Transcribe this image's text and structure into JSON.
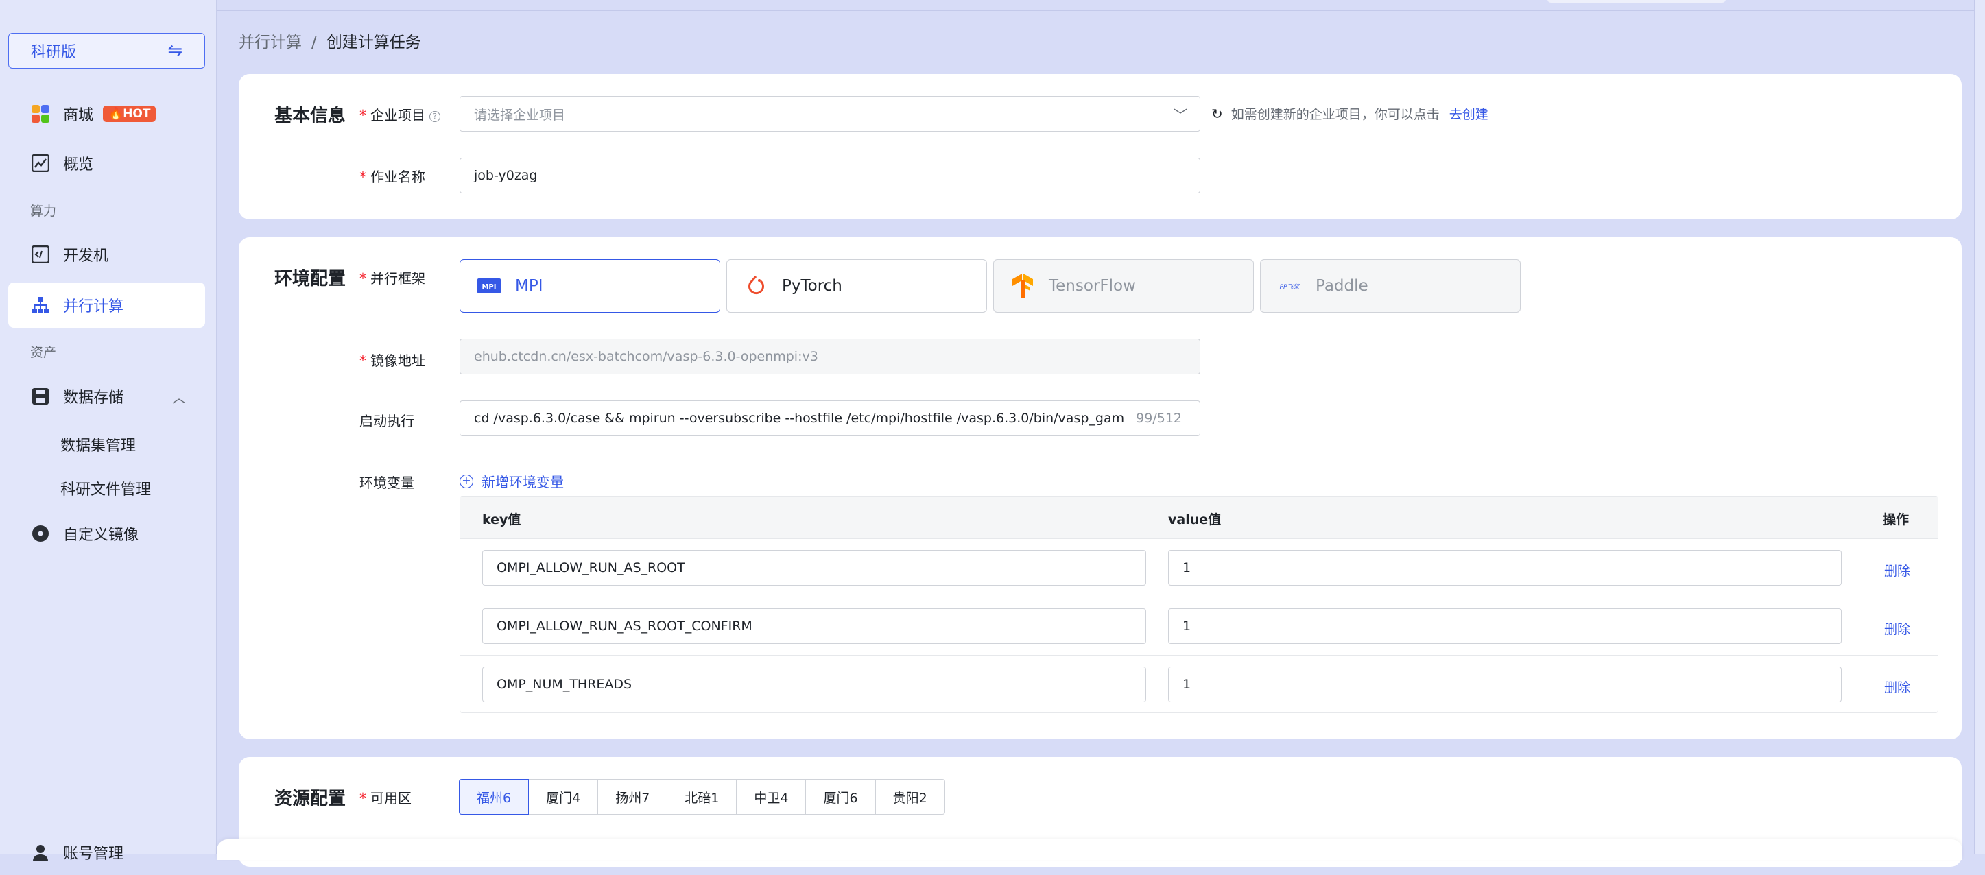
{
  "sidebar": {
    "edition": "科研版",
    "items": {
      "mall": "商城",
      "hot": "HOT",
      "overview": "概览",
      "group_compute": "算力",
      "devmachine": "开发机",
      "parallel": "并行计算",
      "group_assets": "资产",
      "storage": "数据存储",
      "dataset": "数据集管理",
      "research_files": "科研文件管理",
      "custom_image": "自定义镜像",
      "account": "账号管理"
    }
  },
  "breadcrumb": {
    "parent": "并行计算",
    "separator": "/",
    "current": "创建计算任务"
  },
  "basic": {
    "title": "基本信息",
    "project_label": "企业项目",
    "project_placeholder": "请选择企业项目",
    "hint_text": "如需创建新的企业项目，你可以点击",
    "hint_link": "去创建",
    "jobname_label": "作业名称",
    "jobname_value": "job-y0zag"
  },
  "env": {
    "title": "环境配置",
    "framework_label": "并行框架",
    "frameworks": [
      {
        "name": "MPI",
        "logo": "MPI",
        "state": "selected"
      },
      {
        "name": "PyTorch",
        "state": "normal"
      },
      {
        "name": "TensorFlow",
        "state": "disabled"
      },
      {
        "name": "Paddle",
        "logo": "PP飞桨",
        "state": "disabled"
      }
    ],
    "image_label": "镜像地址",
    "image_value": "ehub.ctcdn.cn/esx-batchcom/vasp-6.3.0-openmpi:v3",
    "cmd_label": "启动执行",
    "cmd_value": "cd /vasp.6.3.0/case && mpirun --oversubscribe --hostfile /etc/mpi/hostfile /vasp.6.3.0/bin/vasp_gam",
    "cmd_count": "99/512",
    "vars_label": "环境变量",
    "add_var": "新增环境变量",
    "table": {
      "col_key": "key值",
      "col_value": "value值",
      "col_op": "操作",
      "delete": "删除",
      "rows": [
        {
          "key": "OMPI_ALLOW_RUN_AS_ROOT",
          "value": "1"
        },
        {
          "key": "OMPI_ALLOW_RUN_AS_ROOT_CONFIRM",
          "value": "1"
        },
        {
          "key": "OMP_NUM_THREADS",
          "value": "1"
        }
      ]
    }
  },
  "resource": {
    "title": "资源配置",
    "zone_label": "可用区",
    "zones": [
      "福州6",
      "厦门4",
      "扬州7",
      "北碚1",
      "中卫4",
      "厦门6",
      "贵阳2"
    ],
    "selected_zone": "福州6"
  },
  "colors": {
    "accent": "#3558e6",
    "hot": "#f05a38",
    "required": "#f5222d"
  }
}
